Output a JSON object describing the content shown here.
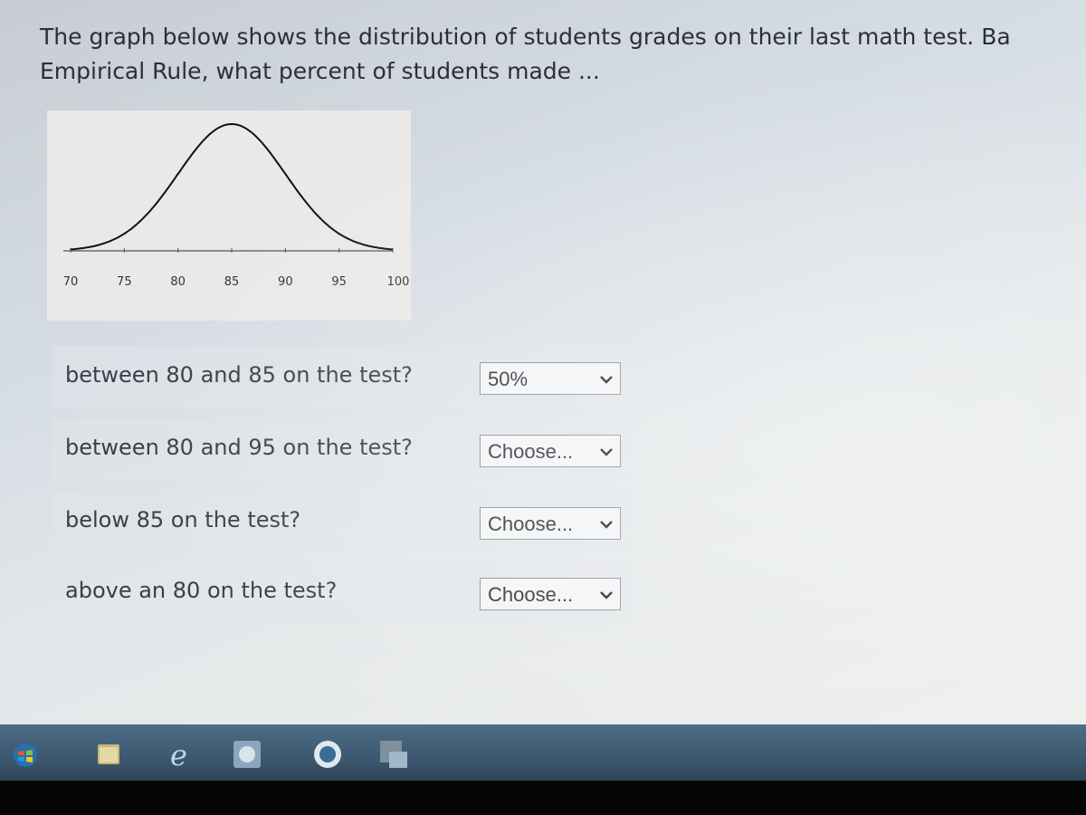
{
  "question": {
    "line1": "The graph below shows the distribution of students grades on their last math test. Ba",
    "line2": "Empirical Rule, what percent of students made ..."
  },
  "chart_data": {
    "type": "line",
    "x_tick_labels": [
      "70",
      "75",
      "80",
      "85",
      "90",
      "95",
      "100"
    ],
    "x_ticks": [
      70,
      75,
      80,
      85,
      90,
      95,
      100
    ],
    "mean": 85,
    "std_dev": 5,
    "xlim": [
      70,
      100
    ]
  },
  "rows": [
    {
      "label": "between 80 and 85 on the test?",
      "selected": "50%"
    },
    {
      "label": "between 80 and 95 on the test?",
      "selected": "Choose..."
    },
    {
      "label": "below 85 on the test?",
      "selected": "Choose..."
    },
    {
      "label": "above an 80 on the test?",
      "selected": "Choose..."
    }
  ],
  "taskbar": {
    "icons": [
      "start-orb-icon",
      "windows-explorer-icon",
      "internet-explorer-icon",
      "notes-app-icon",
      "media-player-icon",
      "language-bar-icon"
    ]
  }
}
